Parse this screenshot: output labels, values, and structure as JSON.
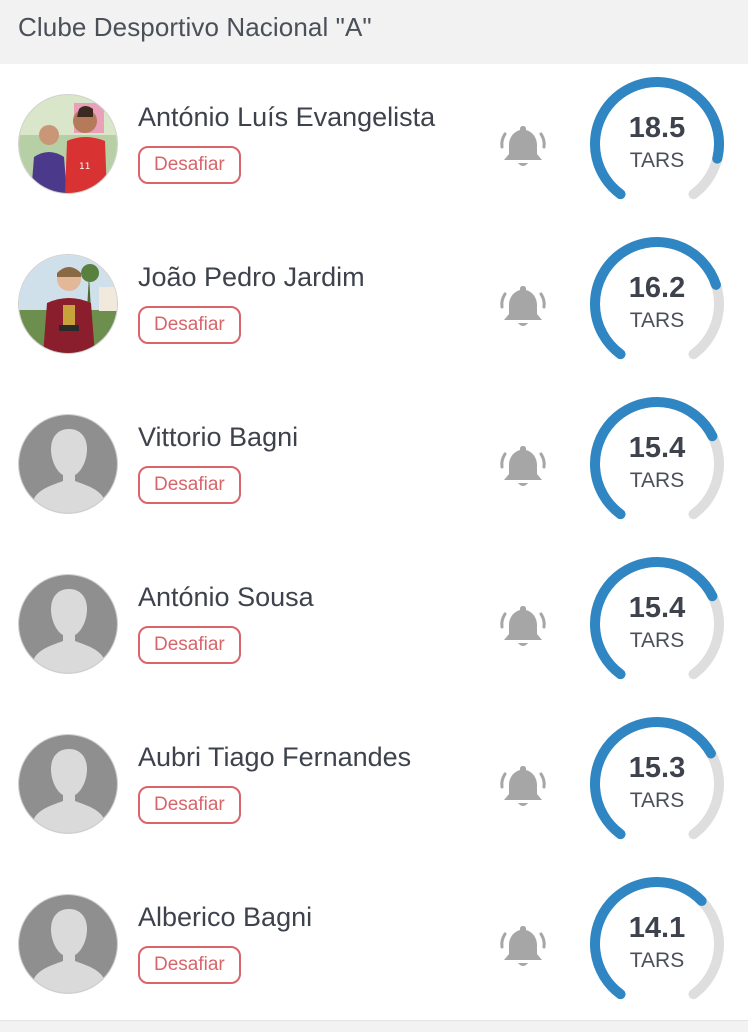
{
  "header": {
    "title": "Clube Desportivo Nacional \"A\""
  },
  "players": [
    {
      "name": "António Luís Evangelista",
      "challenge_label": "Desafiar",
      "rating": "18.5",
      "rating_fraction": 0.86,
      "unit": "TARS",
      "avatar": "photo-father-son"
    },
    {
      "name": "João Pedro Jardim",
      "challenge_label": "Desafiar",
      "rating": "16.2",
      "rating_fraction": 0.75,
      "unit": "TARS",
      "avatar": "photo-trophy"
    },
    {
      "name": "Vittorio Bagni",
      "challenge_label": "Desafiar",
      "rating": "15.4",
      "rating_fraction": 0.72,
      "unit": "TARS",
      "avatar": "placeholder"
    },
    {
      "name": "António Sousa",
      "challenge_label": "Desafiar",
      "rating": "15.4",
      "rating_fraction": 0.72,
      "unit": "TARS",
      "avatar": "placeholder"
    },
    {
      "name": "Aubri Tiago Fernandes",
      "challenge_label": "Desafiar",
      "rating": "15.3",
      "rating_fraction": 0.71,
      "unit": "TARS",
      "avatar": "placeholder"
    },
    {
      "name": "Alberico Bagni",
      "challenge_label": "Desafiar",
      "rating": "14.1",
      "rating_fraction": 0.66,
      "unit": "TARS",
      "avatar": "placeholder"
    }
  ],
  "colors": {
    "accent": "#2f86c2",
    "track": "#dedede",
    "challenge": "#d9646a",
    "bell": "#a6a6a6",
    "header_bg": "#f2f2f2"
  },
  "icons": {
    "notify": "bell-icon",
    "avatar_default": "person-silhouette-icon"
  }
}
